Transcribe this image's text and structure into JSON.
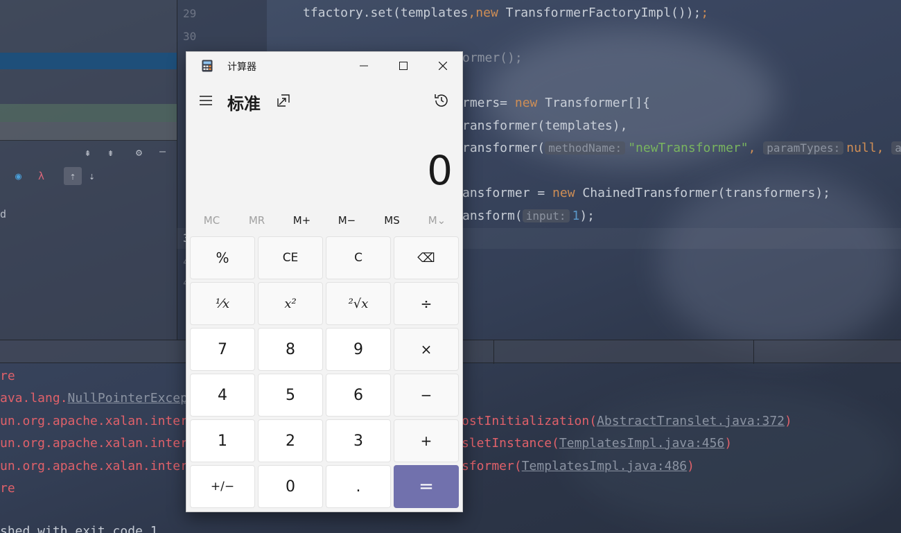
{
  "editor": {
    "line_numbers": [
      "29",
      "30",
      "3",
      "3",
      "3",
      "3",
      "3",
      "3",
      "3",
      "3",
      "4",
      "4"
    ],
    "lines": [
      {
        "text": "tfactory.set(templates",
        "kw": "new",
        "after": " TransformerFactoryImpl());"
      },
      {
        "text": "ormer();"
      },
      {
        "text_pre": "rmers= ",
        "kw": "new",
        "after": " Transformer[]{"
      },
      {
        "text": "ransformer(templates),"
      },
      {
        "text_pre": "ransformer(",
        "hint1": "methodName:",
        "str": "\"newTransformer\"",
        "hint2": "paramTypes:",
        "kw2": "null,",
        "hint3": "ar"
      },
      {
        "text_pre": "ansformer = ",
        "kw": "new",
        "after": " ChainedTransformer(transformers);"
      },
      {
        "text_pre": "ansform(",
        "hint1": "input:",
        "num": "1",
        "after": ");"
      }
    ],
    "left_panel_text": "d"
  },
  "console": {
    "lines": [
      {
        "text": "re"
      },
      {
        "text": "ava.lang.",
        "link": "NullPointerExcep"
      },
      {
        "text": "un.org.apache.xalan.inter",
        "right": "ostInitialization(",
        "link": "AbstractTranslet.java:372",
        "end": ")"
      },
      {
        "text": "un.org.apache.xalan.inter",
        "right": "sletInstance(",
        "link": "TemplatesImpl.java:456",
        "end": ")"
      },
      {
        "text": "un.org.apache.xalan.inter",
        "right": "sformer(",
        "link": "TemplatesImpl.java:486",
        "end": ")"
      },
      {
        "text": "re"
      },
      {
        "text": "shed with exit code 1"
      }
    ]
  },
  "calculator": {
    "window_title": "计算器",
    "mode": "标准",
    "display_value": "0",
    "memory": [
      "MC",
      "MR",
      "M+",
      "M−",
      "MS",
      "M⌄"
    ],
    "keys": [
      [
        "%",
        "CE",
        "C",
        "⌫"
      ],
      [
        "¹⁄x",
        "x²",
        "²√x",
        "÷"
      ],
      [
        "7",
        "8",
        "9",
        "×"
      ],
      [
        "4",
        "5",
        "6",
        "−"
      ],
      [
        "1",
        "2",
        "3",
        "+"
      ],
      [
        "+/−",
        "0",
        ".",
        "="
      ]
    ],
    "accent_color": "#7171ad"
  }
}
